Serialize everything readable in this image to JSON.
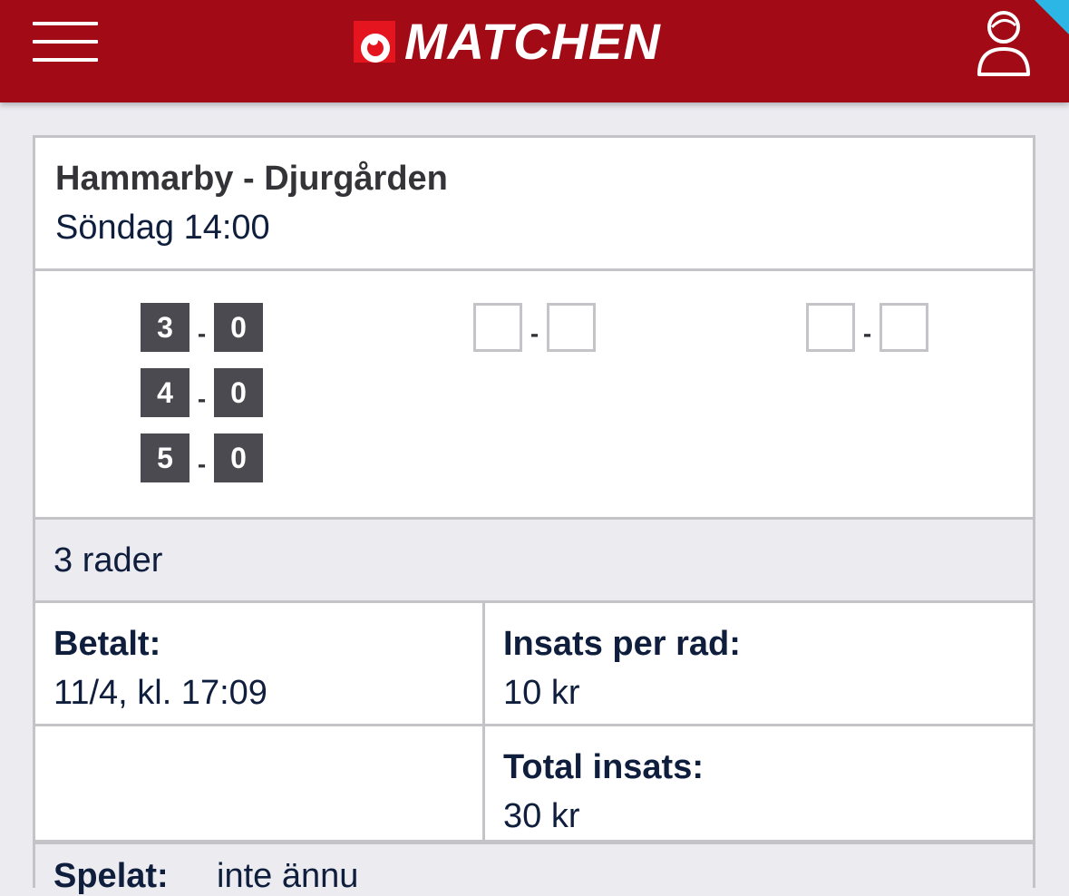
{
  "header": {
    "brand": "MATCHEN",
    "bg_color": "#a20b16",
    "logo_mark_color": "#e51520",
    "menu_icon": "hamburger-menu-icon",
    "user_icon": "user-profile-icon"
  },
  "match": {
    "title": "Hammarby - Djurgården",
    "time": "Söndag 14:00"
  },
  "scores": {
    "columns": [
      {
        "rows": [
          {
            "home": "3",
            "away": "0"
          },
          {
            "home": "4",
            "away": "0"
          },
          {
            "home": "5",
            "away": "0"
          }
        ]
      },
      {
        "rows": [
          {
            "home": "",
            "away": ""
          }
        ]
      },
      {
        "rows": [
          {
            "home": "",
            "away": ""
          }
        ]
      }
    ],
    "separator": "-"
  },
  "summary": {
    "rows_label": "3 rader",
    "paid_label": "Betalt:",
    "paid_value": "11/4, kl. 17:09",
    "stake_per_row_label": "Insats per rad:",
    "stake_per_row_value": "10 kr",
    "total_stake_label": "Total insats:",
    "total_stake_value": "30 kr",
    "next_label": "Spelat:",
    "next_value": "inte ännu"
  }
}
